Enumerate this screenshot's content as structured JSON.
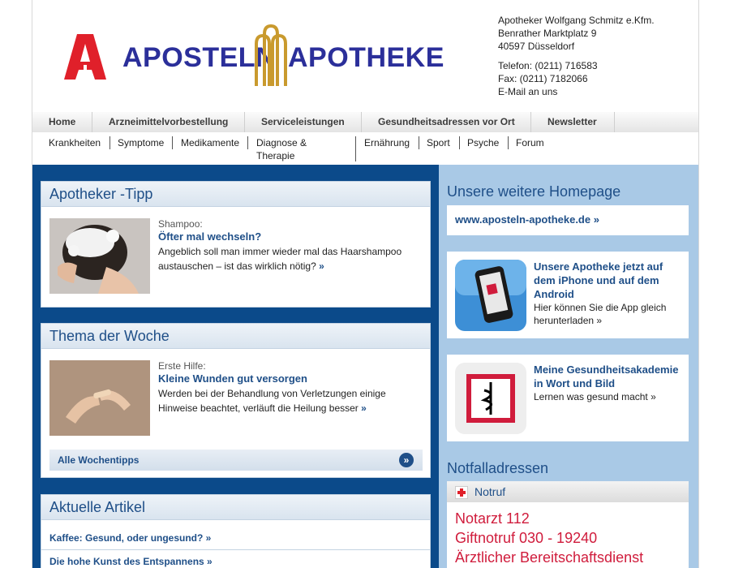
{
  "header": {
    "logo_left": "APOSTELN",
    "logo_right": "APOTHEKE",
    "contact": {
      "name": "Apotheker Wolfgang Schmitz e.Kfm.",
      "street": "Benrather Marktplatz 9",
      "city": "40597 Düsseldorf",
      "phone": "Telefon: (0211) 716583",
      "fax": "Fax: (0211) 7182066",
      "email": "E-Mail an uns"
    }
  },
  "mainnav": [
    "Home",
    "Arzneimittelvorbestellung",
    "Serviceleistungen",
    "Gesundheitsadressen vor Ort",
    "Newsletter"
  ],
  "subnav": [
    "Krankheiten",
    "Symptome",
    "Medikamente",
    "Diagnose &",
    "Therapie",
    "Ernährung",
    "Sport",
    "Psyche",
    "Forum"
  ],
  "tipp": {
    "heading": "Apotheker -Tipp",
    "kicker": "Shampoo:",
    "title": "Öfter mal wechseln?",
    "desc1": "Angeblich soll man immer wieder mal das Haarshampoo",
    "desc2": "austauschen – ist das wirklich nötig?",
    "more": "»"
  },
  "thema": {
    "heading": "Thema der Woche",
    "kicker": "Erste Hilfe:",
    "title": "Kleine Wunden gut versorgen",
    "desc1": "Werden bei der Behandlung von Verletzungen einige",
    "desc2": "Hinweise beachtet, verläuft die Heilung besser",
    "more": "»",
    "all_label": "Alle Wochentipps",
    "all_icon": "»"
  },
  "artikel": {
    "heading": "Aktuelle Artikel",
    "items": [
      "Kaffee: Gesund, oder ungesund? »",
      "Die hohe Kunst des Entspannens »"
    ]
  },
  "homepage": {
    "heading": "Unsere weitere Homepage",
    "link": "www.aposteln-apotheke.de »"
  },
  "app": {
    "title1": "Unsere Apotheke jetzt auf",
    "title2": "dem iPhone und auf dem",
    "title3": "Android",
    "desc1": "Hier können Sie die App gleich",
    "desc2": "herunterladen »"
  },
  "akademie": {
    "title1": "Meine Gesundheitsakademie",
    "title2": "in Wort und Bild",
    "desc": "Lernen was gesund macht »"
  },
  "notfall": {
    "heading": "Notfalladressen",
    "tab": "Notruf",
    "lines": [
      "Notarzt 112",
      "Giftnotruf 030 - 19240",
      "Ärztlicher Bereitschaftsdienst"
    ]
  },
  "colors": {
    "brand_blue": "#2b2f9a",
    "logo_red": "#e0202a",
    "gold": "#c99a2e",
    "link_blue": "#1f4f88",
    "left_bg": "#0b4a8a",
    "right_bg": "#a9c9e6",
    "notfall_red": "#d01c3c"
  }
}
